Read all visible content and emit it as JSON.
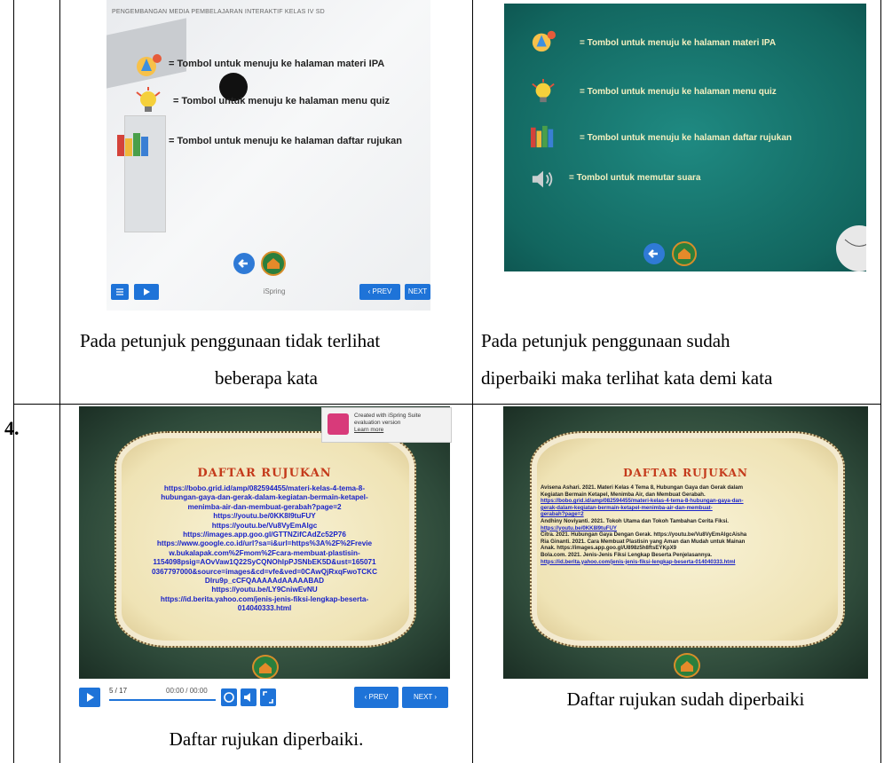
{
  "table": {
    "row4_number": "4."
  },
  "slide_menu_old": {
    "header": "PENGEMBANGAN MEDIA PEMBELAJARAN INTERAKTIF KELAS IV SD",
    "rows": [
      "= Tombol untuk menuju ke halaman materi IPA",
      "= Tombol untuk menuju ke halaman menu quiz",
      "= Tombol untuk menuju ke halaman daftar rujukan"
    ],
    "controls": {
      "brand": "iSpring",
      "prev": "‹ PREV",
      "next": "NEXT"
    }
  },
  "slide_menu_new": {
    "rows": [
      "= Tombol untuk menuju ke halaman materi IPA",
      "= Tombol untuk menuju ke halaman menu quiz",
      "= Tombol untuk menuju ke halaman daftar rujukan",
      "= Tombol untuk memutar suara"
    ]
  },
  "captions": {
    "before_line1": "Pada petunjuk penggunaan tidak terlihat",
    "before_line2": "beberapa kata",
    "after_line1": "Pada petunjuk penggunaan sudah",
    "after_line2": "diperbaiki maka terlihat kata demi kata",
    "ref_before": "Daftar rujukan diperbaiki.",
    "ref_after": "Daftar rujukan sudah diperbaiki"
  },
  "ref_old": {
    "title": "DAFTAR RUJUKAN",
    "badge": [
      "Created with iSpring Suite",
      "evaluation version",
      "Learn more"
    ],
    "links": [
      "https://bobo.grid.id/amp/082594455/materi-kelas-4-tema-8-",
      "hubungan-gaya-dan-gerak-dalam-kegiatan-bermain-ketapel-",
      "menimba-air-dan-membuat-gerabah?page=2",
      "https://youtu.be/0KK8I9tuFUY",
      "https://youtu.be/Vu8VyEmAlgc",
      "https://images.app.goo.gl/GTTNZifCAdZc52P76",
      "https://www.google.co.id/url?sa=i&url=https%3A%2F%2Frevie",
      "w.bukalapak.com%2Fmom%2Fcara-membuat-plastisin-",
      "1154098psig=AOvVaw1Q22SyCQNOhlpPJSNbEK5D&ust=165071",
      "0367797000&source=images&cd=vfe&ved=0CAwQjRxqFwoTCKC",
      "Dlru9p_cCFQAAAAAdAAAAABAD",
      "https://youtu.be/LY9CniwEvNU",
      "https://id.berita.yahoo.com/jenis-jenis-fiksi-lengkap-beserta-",
      "014040333.html"
    ],
    "player": {
      "page": "5 / 17",
      "time": "00:00 / 00:00",
      "prev": "‹ PREV",
      "next": "NEXT ›"
    }
  },
  "ref_new": {
    "title": "DAFTAR RUJUKAN",
    "entries": [
      {
        "t": "Avisena Ashari. 2021. Materi Kelas 4 Tema 8, Hubungan Gaya dan Gerak dalam",
        "u": false
      },
      {
        "t": "Kegiatan Bermain Ketapel, Menimba Air, dan Membuat Gerabah.",
        "u": false
      },
      {
        "t": "https://bobo.grid.id/amp/082594455/materi-kelas-4-tema-8-hubungan-gaya-dan-",
        "u": true
      },
      {
        "t": "gerak-dalam-kegiatan-bermain-ketapel-menimba-air-dan-membuat-",
        "u": true
      },
      {
        "t": "gerabah?page=2",
        "u": true
      },
      {
        "t": "Andhiny Noviyanti. 2021. Tokoh Utama dan Tokoh Tambahan Cerita Fiksi.",
        "u": false
      },
      {
        "t": "https://youtu.be/0KK8I9tuFUY",
        "u": true
      },
      {
        "t": "Citra. 2021. Hubungan Gaya Dengan Gerak. https://youtu.be/Vu8VyEmAlgcAisha",
        "u": false
      },
      {
        "t": "Ria Ginanti. 2021. Cara Membuat Plastisin yang Aman dan Mudah untuk Mainan",
        "u": false
      },
      {
        "t": "Anak. https://images.app.goo.gl/U898z5h8ftsEYKpX9",
        "u": false
      },
      {
        "t": "Bola.com. 2021. Jenis-Jenis Fiksi Lengkap Beserta Penjelasannya.",
        "u": false
      },
      {
        "t": "https://id.berita.yahoo.com/jenis-jenis-fiksi-lengkap-beserta-014040333.html",
        "u": true
      }
    ]
  }
}
